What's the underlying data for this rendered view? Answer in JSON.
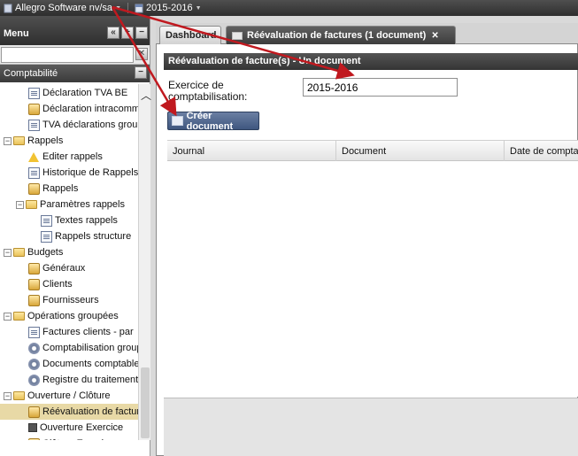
{
  "topbar": {
    "company": "Allegro Software nv/sa",
    "year": "2015-2016"
  },
  "menu": {
    "title": "Menu",
    "search_value": "",
    "section": "Comptabilité"
  },
  "tree": [
    {
      "label": "Déclaration TVA BE",
      "icon": "doc-icon",
      "indent": 2
    },
    {
      "label": "Déclaration intracommunautaire",
      "icon": "folder-doc-icon",
      "indent": 2
    },
    {
      "label": "TVA déclarations groupées",
      "icon": "doc-stack-icon",
      "indent": 2
    },
    {
      "label": "Rappels",
      "icon": "folder-icon",
      "indent": 0,
      "expander": "−"
    },
    {
      "label": "Editer rappels",
      "icon": "warning-icon",
      "indent": 2
    },
    {
      "label": "Historique de Rappels",
      "icon": "doc-icon",
      "indent": 2
    },
    {
      "label": "Rappels",
      "icon": "print-icon",
      "indent": 2
    },
    {
      "label": "Paramètres rappels",
      "icon": "folder-icon",
      "indent": 1,
      "expander": "−"
    },
    {
      "label": "Textes rappels",
      "icon": "text-doc-icon",
      "indent": 3
    },
    {
      "label": "Rappels structure",
      "icon": "structure-icon",
      "indent": 3
    },
    {
      "label": "Budgets",
      "icon": "folder-icon",
      "indent": 0,
      "expander": "−"
    },
    {
      "label": "Généraux",
      "icon": "gold-icon",
      "indent": 2
    },
    {
      "label": "Clients",
      "icon": "gold-icon",
      "indent": 2
    },
    {
      "label": "Fournisseurs",
      "icon": "gold-icon",
      "indent": 2
    },
    {
      "label": "Opérations groupées",
      "icon": "folder-icon",
      "indent": 0,
      "expander": "−"
    },
    {
      "label": "Factures clients - par",
      "icon": "doc-icon",
      "indent": 2
    },
    {
      "label": "Comptabilisation groupée",
      "icon": "gear-doc-icon",
      "indent": 2
    },
    {
      "label": "Documents comptables",
      "icon": "gear-doc-icon",
      "indent": 2
    },
    {
      "label": "Registre du traitement",
      "icon": "gear-doc-icon",
      "indent": 2
    },
    {
      "label": "Ouverture / Clôture",
      "icon": "folder-icon",
      "indent": 0,
      "expander": "−"
    },
    {
      "label": "Réévaluation de factures",
      "icon": "gold-doc-icon",
      "indent": 2,
      "selected": true
    },
    {
      "label": "Ouverture Exercice",
      "icon": "dark-square-icon",
      "indent": 2
    },
    {
      "label": "Clôture Exercice",
      "icon": "gold-icon",
      "indent": 2
    }
  ],
  "tabs": [
    {
      "label": "Dashboard"
    },
    {
      "label": "Réévaluation de factures (1 document)"
    }
  ],
  "form": {
    "header": "Réévaluation de facture(s) - Un document",
    "exercise_label": "Exercice de comptabilisation:",
    "exercise_value": "2015-2016",
    "create_button": "Créer document"
  },
  "grid": {
    "columns": [
      "Journal",
      "Document",
      "Date de comptabilisation"
    ]
  },
  "colors": {
    "annotation_arrow": "#c0191f",
    "selected_row": "#e8d9a6",
    "button_blue": "#4a6189"
  }
}
